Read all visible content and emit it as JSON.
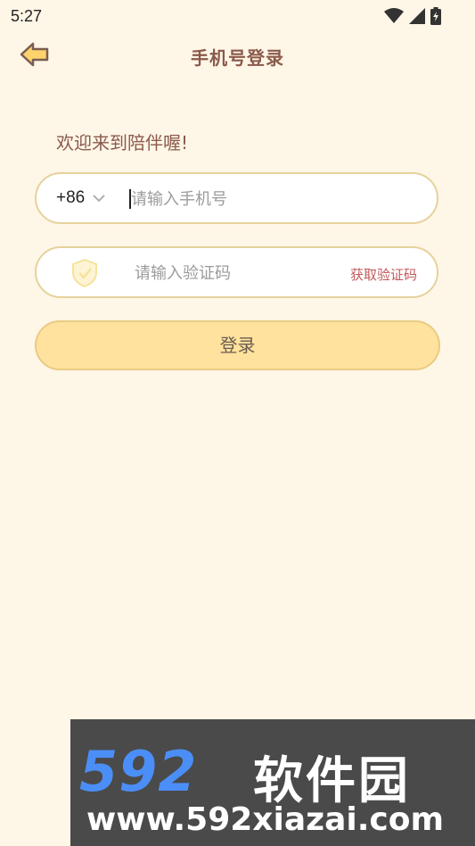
{
  "status_bar": {
    "time": "5:27",
    "icons": [
      "wifi-icon",
      "cellular-signal-icon",
      "battery-charging-icon"
    ]
  },
  "header": {
    "back_icon": "back-arrow-icon",
    "title": "手机号登录"
  },
  "welcome_text": "欢迎来到陪伴喔!",
  "phone_field": {
    "country_code": "+86",
    "placeholder": "请输入手机号",
    "value": ""
  },
  "code_field": {
    "icon": "shield-check-icon",
    "placeholder": "请输入验证码",
    "value": "",
    "get_code_label": "获取验证码"
  },
  "login_button": {
    "label": "登录"
  },
  "watermark": {
    "logo_number": "592",
    "brand": "软件园",
    "url": "www.592xiazai.com"
  },
  "colors": {
    "background": "#FEF6E6",
    "title": "#8A5A4C",
    "field_border": "#E6D29C",
    "button_fill": "#FFE29D",
    "get_code": "#C0595B"
  }
}
